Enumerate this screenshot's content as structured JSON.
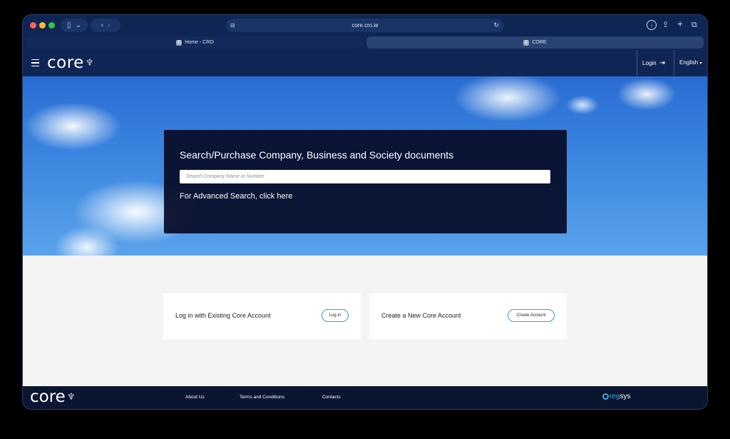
{
  "browser": {
    "url": "core.cro.ie",
    "tabs": [
      {
        "label": "Home - CRO",
        "favicon": "C",
        "active": false
      },
      {
        "label": "CORE",
        "favicon": "C",
        "active": true
      }
    ]
  },
  "header": {
    "logo_text": "core",
    "login_label": "Login",
    "language_label": "English"
  },
  "hero": {
    "title": "Search/Purchase Company, Business and Society documents",
    "search_placeholder": "Search Company Name or Number",
    "advanced_prefix": "For Advanced Search, click ",
    "advanced_link": "here"
  },
  "cards": [
    {
      "label": "Log in with Existing Core Account",
      "button": "Log in"
    },
    {
      "label": "Create a New Core Account",
      "button": "Create Account"
    }
  ],
  "footer": {
    "logo_text": "core",
    "links": [
      "About Us",
      "Terms and Conditions",
      "Contacts"
    ],
    "brand_reg": "reg",
    "brand_sys": "sys"
  },
  "colors": {
    "header_bg": "#0f2553",
    "footer_bg": "#0a1530",
    "accent": "#3aa0c8"
  }
}
